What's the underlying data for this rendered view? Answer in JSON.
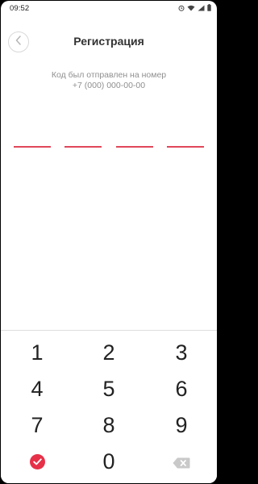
{
  "status_bar": {
    "time": "09:52",
    "icons": [
      "alarm-icon",
      "wifi-icon",
      "signal-icon",
      "battery-icon"
    ]
  },
  "header": {
    "title": "Регистрация",
    "back_icon": "chevron-left-icon"
  },
  "message": {
    "line1": "Код был отправлен на номер",
    "line2": "+7 (000) 000-00-00"
  },
  "code": {
    "slots": [
      "",
      "",
      "",
      ""
    ],
    "accent_color": "#e0485a"
  },
  "keypad": {
    "keys": [
      "1",
      "2",
      "3",
      "4",
      "5",
      "6",
      "7",
      "8",
      "9"
    ],
    "zero": "0",
    "confirm_icon": "check-circle-icon",
    "backspace_icon": "backspace-icon"
  },
  "colors": {
    "accent": "#e63148",
    "title": "#333333",
    "subtitle": "#8f8f8f"
  }
}
